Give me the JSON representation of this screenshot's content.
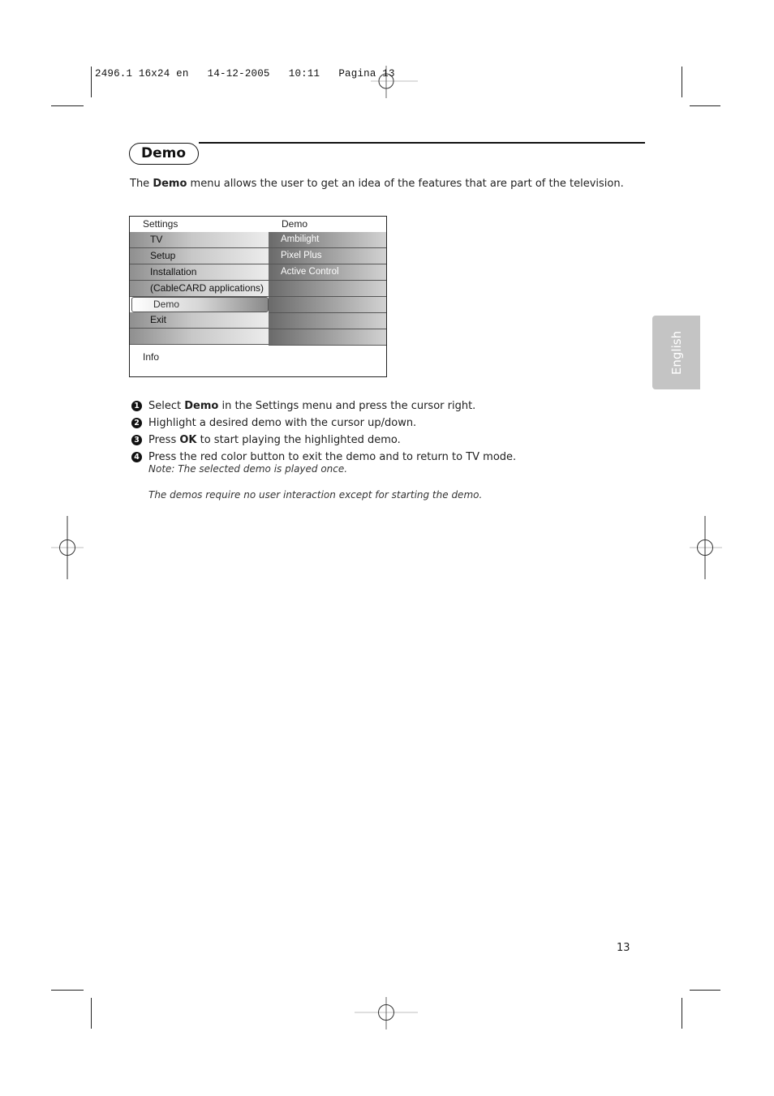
{
  "print_slug": "2496.1 16x24 en   14-12-2005   10:11   Pagina 13",
  "section": {
    "title": "Demo",
    "intro": {
      "before": "The ",
      "bold": "Demo",
      "after": " menu allows the user to get an idea of the features that are part of the television."
    }
  },
  "menu": {
    "header_left": "Settings",
    "header_right": "Demo",
    "left_items": [
      {
        "label": "TV",
        "selected": false
      },
      {
        "label": "Setup",
        "selected": false
      },
      {
        "label": "Installation",
        "selected": false
      },
      {
        "label": "(CableCARD applications)",
        "selected": false
      },
      {
        "label": "Demo",
        "selected": true
      },
      {
        "label": "Exit",
        "selected": false
      },
      {
        "label": "",
        "selected": false
      }
    ],
    "right_items": [
      "Ambilight",
      "Pixel Plus",
      "Active Control",
      "",
      "",
      "",
      ""
    ],
    "info_label": "Info"
  },
  "steps": [
    {
      "number": "1",
      "before": "Select ",
      "bold": "Demo",
      "after": " in the Settings menu and press the cursor right."
    },
    {
      "number": "2",
      "before": "Highlight a desired demo with the cursor up/down.",
      "bold": "",
      "after": ""
    },
    {
      "number": "3",
      "before": "Press ",
      "bold": "OK",
      "after": " to start playing the highlighted demo."
    },
    {
      "number": "4",
      "before": "Press the red color button to exit the demo and to return to TV mode.",
      "bold": "",
      "after": ""
    }
  ],
  "note": "Note: The selected demo is played once.",
  "footnote": "The demos require no user interaction except for starting the demo.",
  "language_tab": "English",
  "page_number": "13"
}
